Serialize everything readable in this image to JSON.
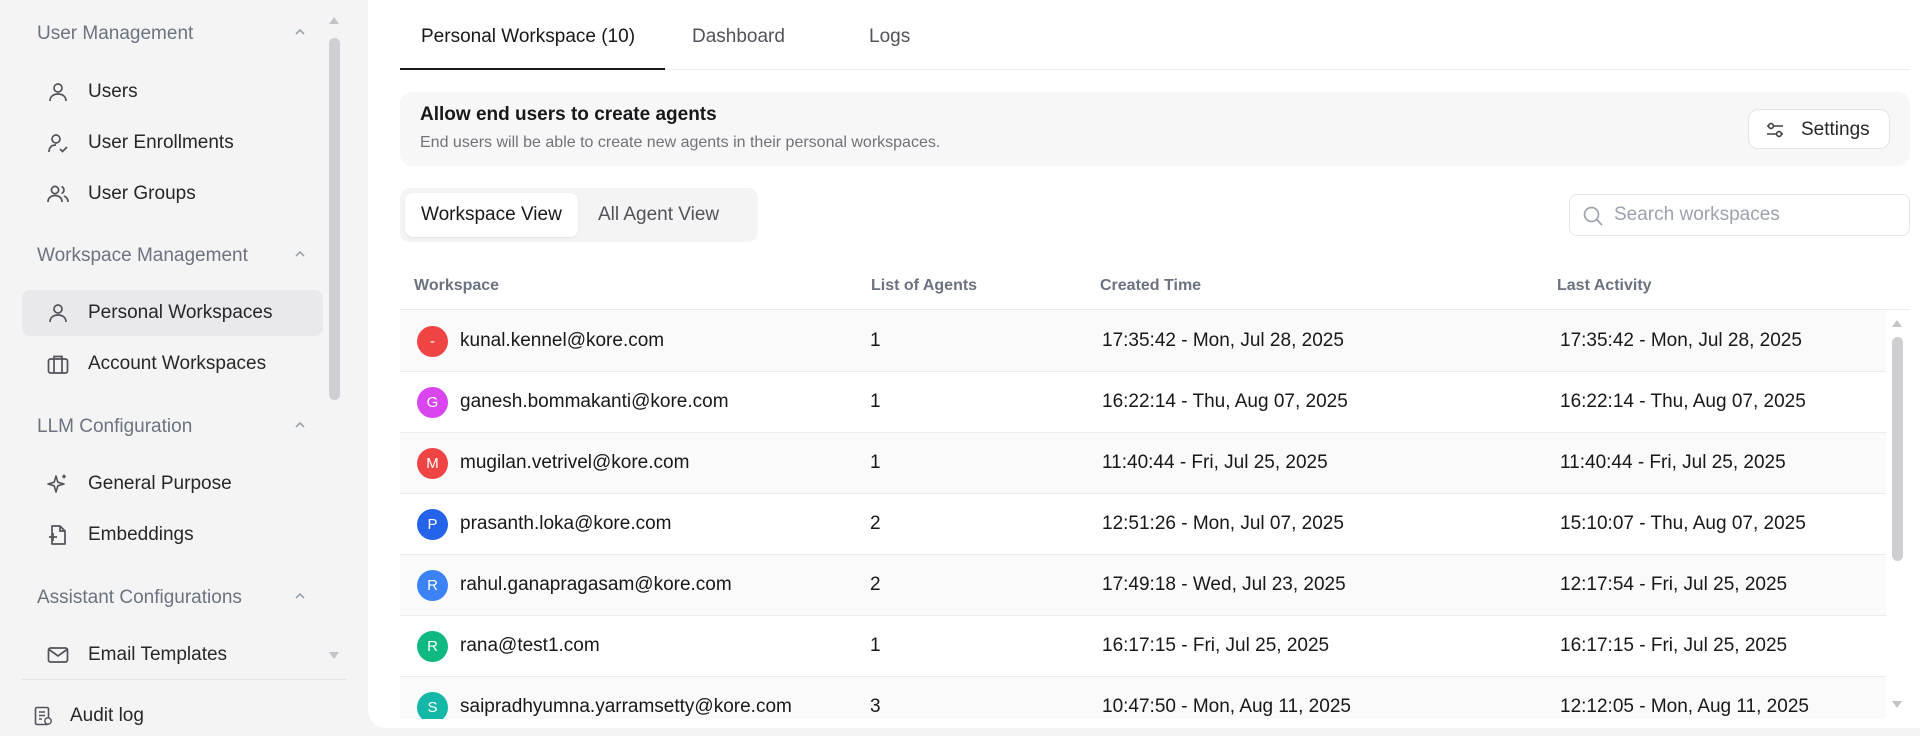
{
  "sidebar": {
    "sections": [
      {
        "title": "User Management",
        "items": [
          {
            "label": "Users",
            "icon": "user-icon"
          },
          {
            "label": "User Enrollments",
            "icon": "user-check-icon"
          },
          {
            "label": "User Groups",
            "icon": "users-icon"
          }
        ]
      },
      {
        "title": "Workspace Management",
        "items": [
          {
            "label": "Personal Workspaces",
            "icon": "user-icon"
          },
          {
            "label": "Account Workspaces",
            "icon": "briefcase-icon"
          }
        ]
      },
      {
        "title": "LLM Configuration",
        "items": [
          {
            "label": "General Purpose",
            "icon": "sparkles-icon"
          },
          {
            "label": "Embeddings",
            "icon": "file-plus-icon"
          }
        ]
      },
      {
        "title": "Assistant Configurations",
        "items": [
          {
            "label": "Email Templates",
            "icon": "mail-icon"
          }
        ]
      }
    ],
    "audit_label": "Audit log"
  },
  "tabs": [
    {
      "label": "Personal Workspace (10)"
    },
    {
      "label": "Dashboard"
    },
    {
      "label": "Logs"
    }
  ],
  "banner": {
    "title": "Allow end users to create agents",
    "subtitle": "End users will be able to create new agents in their personal workspaces.",
    "settings_label": "Settings"
  },
  "view_toggle": {
    "workspace": "Workspace View",
    "all_agent": "All Agent View"
  },
  "search": {
    "placeholder": "Search workspaces",
    "value": ""
  },
  "table": {
    "headers": {
      "workspace": "Workspace",
      "agents": "List of Agents",
      "created": "Created Time",
      "last": "Last Activity"
    },
    "rows": [
      {
        "initial": "-",
        "color": "#ef4444",
        "email": "kunal.kennel@kore.com",
        "agents": "1",
        "created": "17:35:42 - Mon, Jul 28, 2025",
        "last": "17:35:42 - Mon, Jul 28, 2025"
      },
      {
        "initial": "G",
        "color": "#d946ef",
        "email": "ganesh.bommakanti@kore.com",
        "agents": "1",
        "created": "16:22:14 - Thu, Aug 07, 2025",
        "last": "16:22:14 - Thu, Aug 07, 2025"
      },
      {
        "initial": "M",
        "color": "#ef4444",
        "email": "mugilan.vetrivel@kore.com",
        "agents": "1",
        "created": "11:40:44 - Fri, Jul 25, 2025",
        "last": "11:40:44 - Fri, Jul 25, 2025"
      },
      {
        "initial": "P",
        "color": "#2563eb",
        "email": "prasanth.loka@kore.com",
        "agents": "2",
        "created": "12:51:26 - Mon, Jul 07, 2025",
        "last": "15:10:07 - Thu, Aug 07, 2025"
      },
      {
        "initial": "R",
        "color": "#3b82f6",
        "email": "rahul.ganapragasam@kore.com",
        "agents": "2",
        "created": "17:49:18 - Wed, Jul 23, 2025",
        "last": "12:17:54 - Fri, Jul 25, 2025"
      },
      {
        "initial": "R",
        "color": "#10b981",
        "email": "rana@test1.com",
        "agents": "1",
        "created": "16:17:15 - Fri, Jul 25, 2025",
        "last": "16:17:15 - Fri, Jul 25, 2025"
      },
      {
        "initial": "S",
        "color": "#14b8a6",
        "email": "saipradhyumna.yarramsetty@kore.com",
        "agents": "3",
        "created": "10:47:50 - Mon, Aug 11, 2025",
        "last": "12:12:05 - Mon, Aug 11, 2025"
      }
    ]
  }
}
